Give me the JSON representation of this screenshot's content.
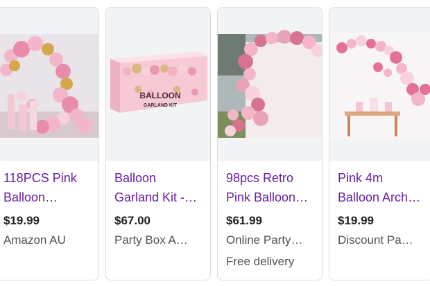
{
  "products": [
    {
      "title_line1": "118PCS Pink",
      "title_line2": "Balloon…",
      "price": "$19.99",
      "store": "Amazon AU",
      "extra": ""
    },
    {
      "title_line1": "Balloon",
      "title_line2": "Garland Kit -…",
      "price": "$67.00",
      "store": "Party Box A…",
      "extra": "",
      "box_text_1": "BALLOON",
      "box_text_2": "GARLAND KIT"
    },
    {
      "title_line1": "98pcs Retro",
      "title_line2": "Pink Balloon…",
      "price": "$61.99",
      "store": "Online Party…",
      "extra": "Free delivery"
    },
    {
      "title_line1": "Pink 4m",
      "title_line2": "Balloon Arch…",
      "price": "$19.99",
      "store": "Discount Pa…",
      "extra": ""
    }
  ]
}
